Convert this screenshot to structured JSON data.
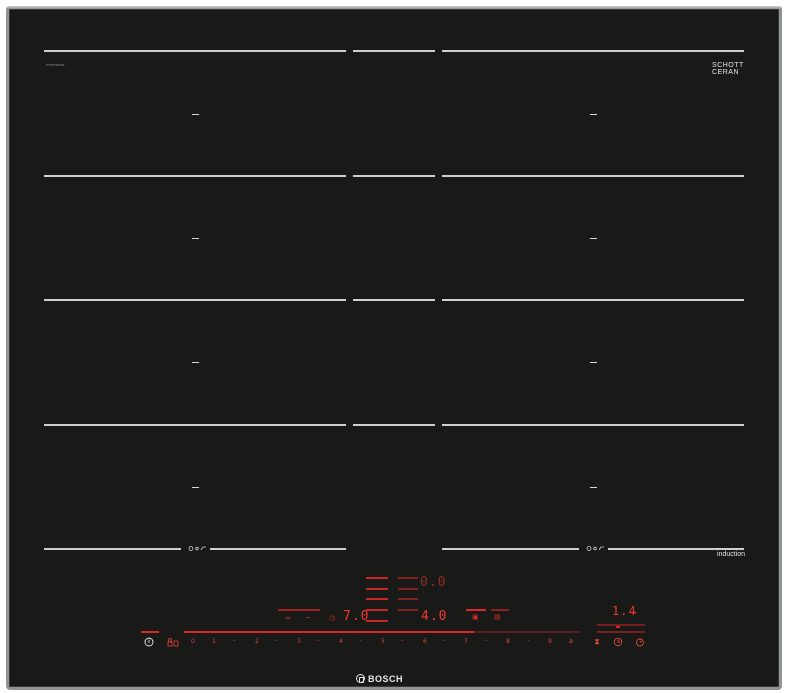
{
  "hob": {
    "model_code": "PXX875D67E",
    "brand_name": "BOSCH",
    "glass_logo_line1": "SCHOTT",
    "glass_logo_line2": "CERAN",
    "glass_logo_sub": "",
    "badge": "induction"
  },
  "zones": {
    "combined_icon": "flex-zone-icon"
  },
  "display": {
    "top_reading": "0.0",
    "left_reading": "7.0",
    "right_reading": "4.0",
    "timer_reading": "1.4"
  },
  "slider": {
    "labels": [
      "0",
      "1",
      "2",
      "3",
      "4",
      "5",
      "6",
      "7",
      "8",
      "9"
    ],
    "active_level": 5
  },
  "controls": {
    "power_icon": "power-icon",
    "child_lock_icon": "child-lock-icon",
    "pan_icon": "pan-icon",
    "timer_icon": "timer-icon",
    "clock_icon": "clock-icon",
    "stopwatch_icon": "stopwatch-icon"
  },
  "colors": {
    "glass": "#191918",
    "frame": "#8f9396",
    "display_red": "#ef3a30",
    "line": "#cfcfcf"
  }
}
